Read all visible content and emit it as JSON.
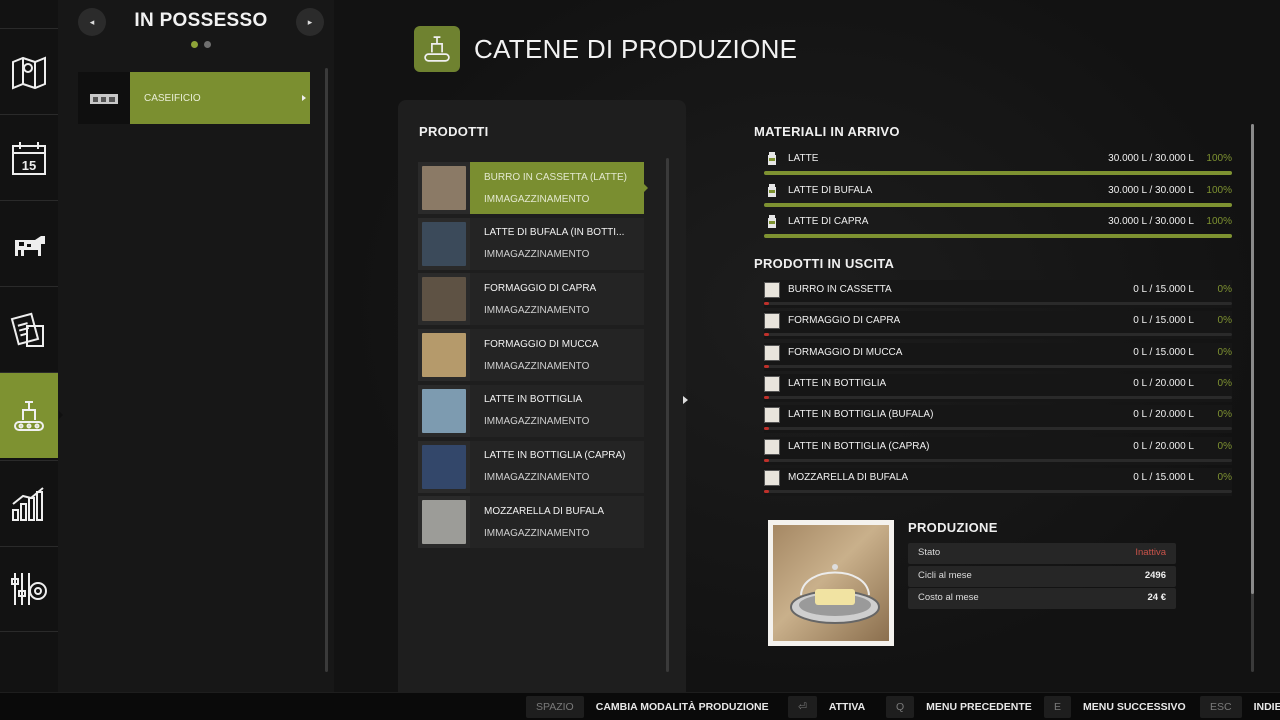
{
  "sidebar_rail": {
    "items": [
      {
        "icon": "map-icon"
      },
      {
        "icon": "calendar-icon",
        "label": "15"
      },
      {
        "icon": "cow-icon"
      },
      {
        "icon": "contracts-icon"
      },
      {
        "icon": "production-icon",
        "active": true
      },
      {
        "icon": "stats-icon"
      },
      {
        "icon": "settings-icon"
      }
    ]
  },
  "owned": {
    "title": "IN POSSESSO",
    "prev_label": "◂",
    "next_label": "▸",
    "items": [
      {
        "label": "CASEIFICIO"
      }
    ]
  },
  "header": {
    "title": "CATENE DI PRODUZIONE"
  },
  "products": {
    "title": "PRODOTTI",
    "items": [
      {
        "name": "BURRO IN CASSETTA (LATTE)",
        "sub": "IMMAGAZZINAMENTO",
        "color": "#8b7a66"
      },
      {
        "name": "LATTE DI BUFALA (IN BOTTI...",
        "sub": "IMMAGAZZINAMENTO",
        "color": "#3b4a5a"
      },
      {
        "name": "FORMAGGIO DI CAPRA",
        "sub": "IMMAGAZZINAMENTO",
        "color": "#5e5244"
      },
      {
        "name": "FORMAGGIO DI MUCCA",
        "sub": "IMMAGAZZINAMENTO",
        "color": "#b59a6b"
      },
      {
        "name": "LATTE IN BOTTIGLIA",
        "sub": "IMMAGAZZINAMENTO",
        "color": "#7d9bb0"
      },
      {
        "name": "LATTE IN BOTTIGLIA (CAPRA)",
        "sub": "IMMAGAZZINAMENTO",
        "color": "#33476a"
      },
      {
        "name": "MOZZARELLA DI BUFALA",
        "sub": "IMMAGAZZINAMENTO",
        "color": "#9c9c98"
      }
    ]
  },
  "incoming": {
    "title": "MATERIALI IN ARRIVO",
    "items": [
      {
        "name": "LATTE",
        "value": "30.000 L / 30.000 L",
        "pct": "100%",
        "level": 1.0
      },
      {
        "name": "LATTE DI BUFALA",
        "value": "30.000 L / 30.000 L",
        "pct": "100%",
        "level": 1.0
      },
      {
        "name": "LATTE DI CAPRA",
        "value": "30.000 L / 30.000 L",
        "pct": "100%",
        "level": 1.0
      }
    ]
  },
  "outgoing": {
    "title": "PRODOTTI IN USCITA",
    "items": [
      {
        "name": "BURRO IN CASSETTA",
        "value": "0 L / 15.000 L",
        "pct": "0%"
      },
      {
        "name": "FORMAGGIO DI CAPRA",
        "value": "0 L / 15.000 L",
        "pct": "0%"
      },
      {
        "name": "FORMAGGIO DI MUCCA",
        "value": "0 L / 15.000 L",
        "pct": "0%"
      },
      {
        "name": "LATTE IN BOTTIGLIA",
        "value": "0 L / 20.000 L",
        "pct": "0%"
      },
      {
        "name": "LATTE IN BOTTIGLIA (BUFALA)",
        "value": "0 L / 20.000 L",
        "pct": "0%"
      },
      {
        "name": "LATTE IN BOTTIGLIA (CAPRA)",
        "value": "0 L / 20.000 L",
        "pct": "0%"
      },
      {
        "name": "MOZZARELLA DI BUFALA",
        "value": "0 L / 15.000 L",
        "pct": "0%"
      }
    ]
  },
  "production": {
    "title": "PRODUZIONE",
    "stats": [
      {
        "label": "Stato",
        "value": "Inattiva",
        "bad": true
      },
      {
        "label": "Cicli al mese",
        "value": "2496"
      },
      {
        "label": "Costo al mese",
        "value": "24 €"
      }
    ]
  },
  "bottom_bar": {
    "hints": [
      {
        "key": "SPAZIO",
        "label": "CAMBIA MODALITÀ PRODUZIONE"
      },
      {
        "key": "⏎",
        "label": "ATTIVA"
      },
      {
        "key": "Q",
        "label": "MENU PRECEDENTE"
      },
      {
        "key": "E",
        "label": "MENU SUCCESSIVO"
      },
      {
        "key": "ESC",
        "label": "INDIETRO"
      }
    ]
  },
  "colors": {
    "accent": "#7e9231",
    "warning": "#c9534a"
  }
}
